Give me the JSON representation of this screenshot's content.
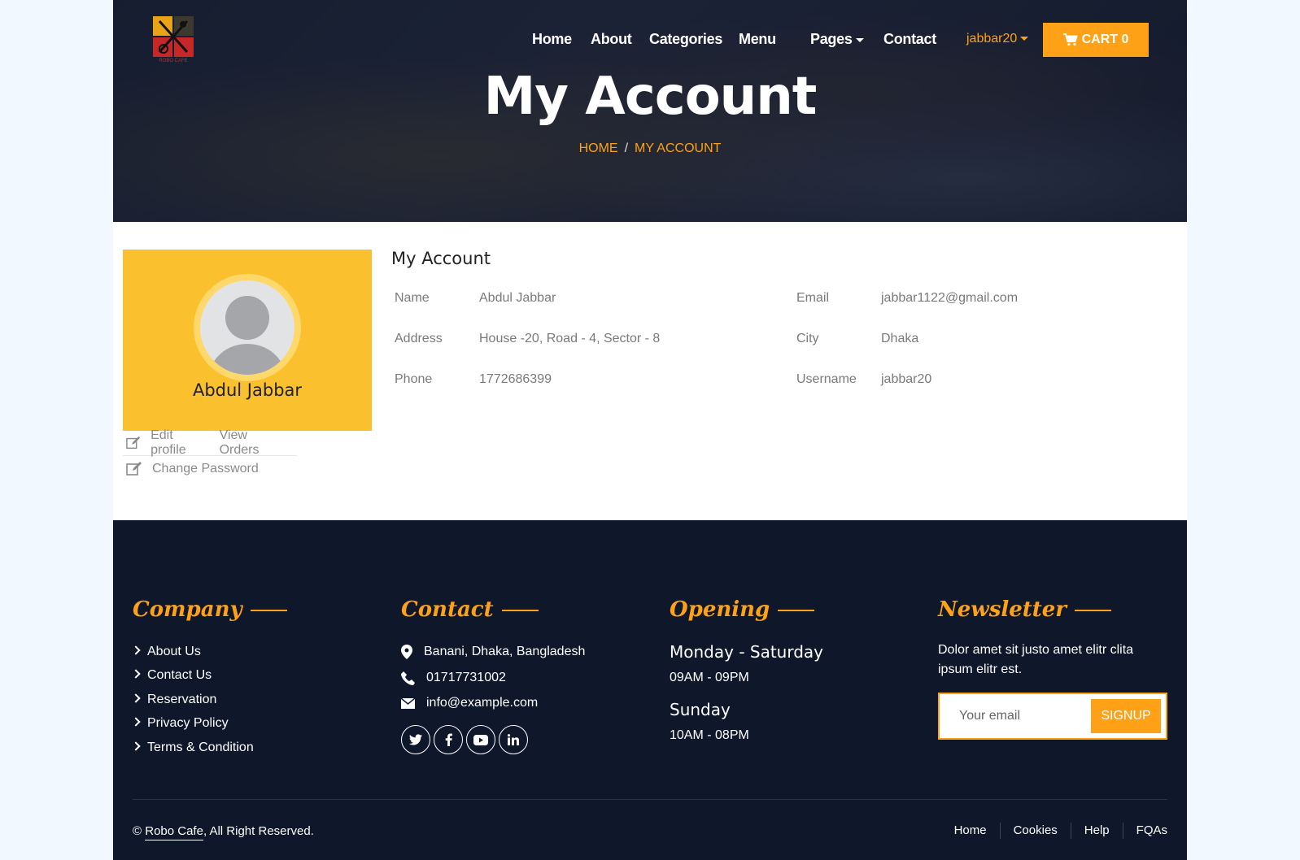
{
  "brand": {
    "logo_alt": "Robo Cafe",
    "accent_color": "#FEA116",
    "dark_bg": "#0f172b",
    "card_color": "#fbc02d"
  },
  "nav": {
    "items": [
      {
        "label": "Home"
      },
      {
        "label": "About"
      },
      {
        "label": "Categories"
      },
      {
        "label": "Menu"
      },
      {
        "label": "Pages",
        "dropdown": true
      },
      {
        "label": "Contact"
      }
    ],
    "user": "jabbar20",
    "cart_label": "CART 0"
  },
  "hero": {
    "title": "My Account",
    "breadcrumb": [
      "HOME",
      "MY ACCOUNT"
    ],
    "breadcrumb_sep": "/"
  },
  "profile": {
    "name": "Abdul Jabbar",
    "links": {
      "edit_profile": "Edit profile",
      "view_orders": "View Orders",
      "change_password": "Change Password"
    }
  },
  "account": {
    "heading": "My Account",
    "fields": [
      {
        "label": "Name",
        "value": "Abdul Jabbar"
      },
      {
        "label": "Email",
        "value": "jabbar1122@gmail.com"
      },
      {
        "label": "Address",
        "value": "House -20, Road - 4, Sector - 8"
      },
      {
        "label": "City",
        "value": "Dhaka"
      },
      {
        "label": "Phone",
        "value": "1772686399"
      },
      {
        "label": "Username",
        "value": "jabbar20"
      }
    ]
  },
  "footer": {
    "company": {
      "heading": "Company",
      "links": [
        "About Us",
        "Contact Us",
        "Reservation",
        "Privacy Policy",
        "Terms & Condition"
      ]
    },
    "contact": {
      "heading": "Contact",
      "address": "Banani, Dhaka, Bangladesh",
      "phone": "01717731002",
      "email": "info@example.com",
      "social_icons": [
        "twitter-icon",
        "facebook-icon",
        "youtube-icon",
        "linkedin-icon"
      ]
    },
    "opening": {
      "heading": "Opening",
      "days": [
        {
          "day": "Monday - Saturday",
          "hours": "09AM - 09PM"
        },
        {
          "day": "Sunday",
          "hours": "10AM - 08PM"
        }
      ]
    },
    "newsletter": {
      "heading": "Newsletter",
      "text": "Dolor amet sit justo amet elitr clita ipsum elitr est.",
      "placeholder": "Your email",
      "button": "SIGNUP"
    },
    "copyright_prefix": "©",
    "copyright_brand": "Robo Cafe",
    "copyright_suffix": ", All Right Reserved.",
    "bottom_links": [
      "Home",
      "Cookies",
      "Help",
      "FQAs"
    ]
  }
}
